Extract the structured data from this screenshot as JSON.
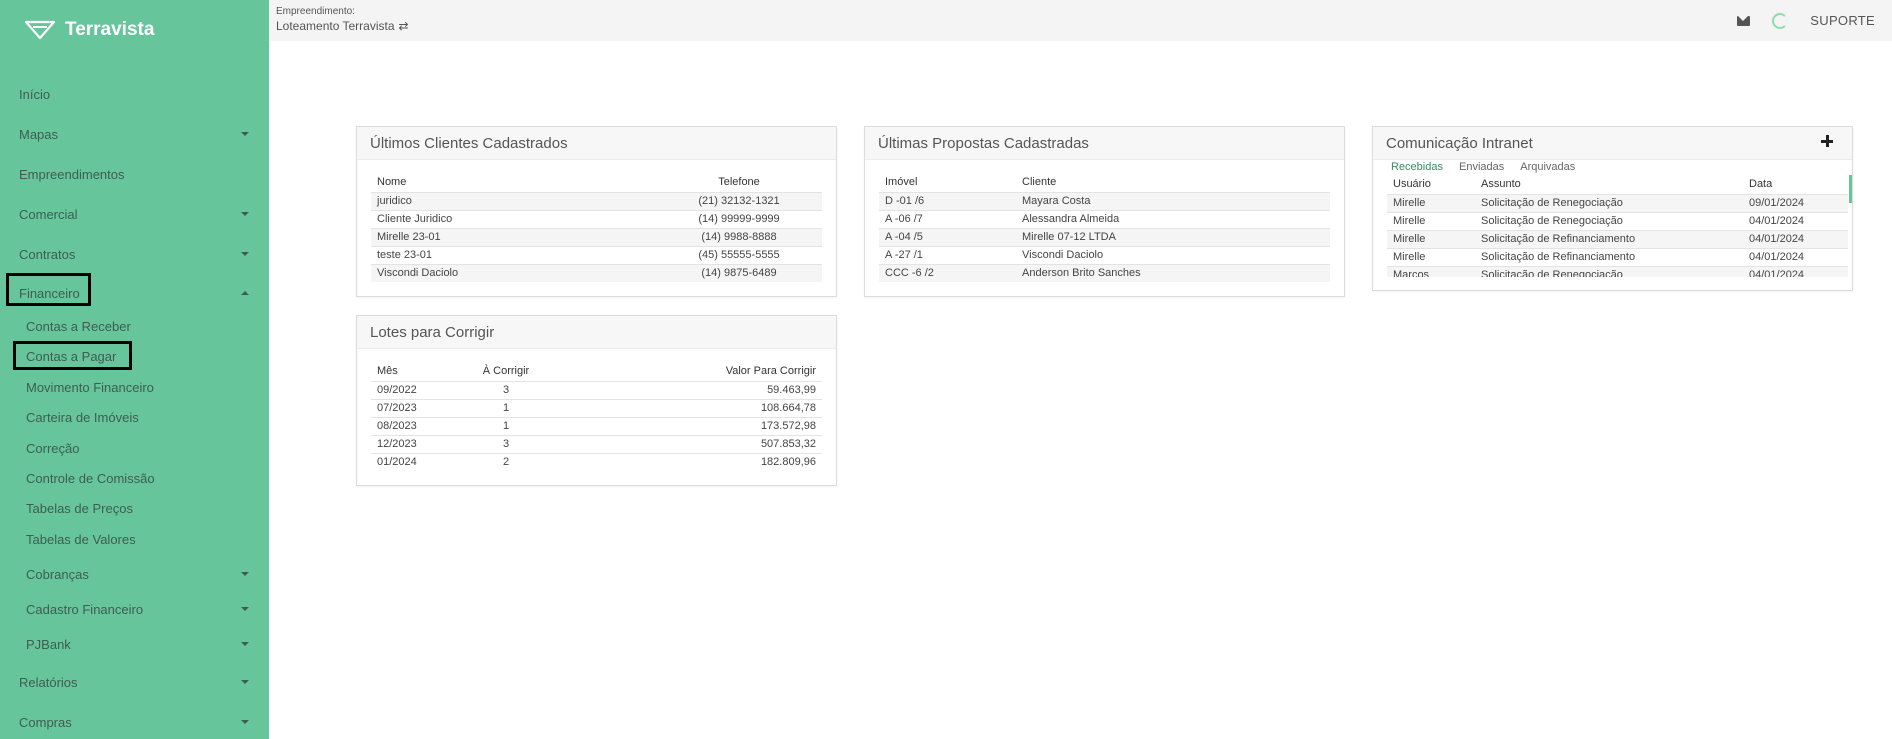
{
  "brand": {
    "name": "Terravista",
    "logo_icon": "terravista-triangle-logo"
  },
  "sidebar": {
    "items": [
      {
        "label": "Início",
        "has_caret": false
      },
      {
        "label": "Mapas",
        "has_caret": true
      },
      {
        "label": "Empreendimentos",
        "has_caret": false
      },
      {
        "label": "Comercial",
        "has_caret": true
      },
      {
        "label": "Contratos",
        "has_caret": true
      },
      {
        "label": "Financeiro",
        "has_caret": true,
        "expanded": true
      }
    ],
    "financeiro_sub": [
      {
        "label": "Contas a Receber"
      },
      {
        "label": "Contas a Pagar"
      },
      {
        "label": "Movimento Financeiro"
      },
      {
        "label": "Carteira de Imóveis"
      },
      {
        "label": "Correção"
      },
      {
        "label": "Controle de Comissão"
      },
      {
        "label": "Tabelas de Preços"
      },
      {
        "label": "Tabelas de Valores"
      },
      {
        "label": "Cobranças",
        "has_caret": true
      },
      {
        "label": "Cadastro Financeiro",
        "has_caret": true
      },
      {
        "label": "PJBank",
        "has_caret": true
      }
    ],
    "bottom_items": [
      {
        "label": "Relatórios",
        "has_caret": true
      },
      {
        "label": "Compras",
        "has_caret": true
      }
    ]
  },
  "topbar": {
    "empreendimento_label": "Empreendimento:",
    "empreendimento_value": "Loteamento Terravista",
    "swap_icon": "⇄",
    "support_label": "SUPORTE"
  },
  "clientes": {
    "title": "Últimos Clientes Cadastrados",
    "headers": [
      "Nome",
      "Telefone"
    ],
    "rows": [
      [
        "juridico",
        "(21) 32132-1321"
      ],
      [
        "Cliente Juridico",
        "(14) 99999-9999"
      ],
      [
        "Mirelle 23-01",
        "(14) 9988-8888"
      ],
      [
        "teste 23-01",
        "(45) 55555-5555"
      ],
      [
        "Viscondi Daciolo",
        "(14) 9875-6489"
      ]
    ]
  },
  "propostas": {
    "title": "Últimas Propostas Cadastradas",
    "headers": [
      "Imóvel",
      "Cliente"
    ],
    "rows": [
      [
        "D -01 /6",
        "Mayara Costa"
      ],
      [
        "A -06 /7",
        "Alessandra Almeida"
      ],
      [
        "A -04 /5",
        "Mirelle 07-12 LTDA"
      ],
      [
        "A -27 /1",
        "Viscondi Daciolo"
      ],
      [
        "CCC -6 /2",
        "Anderson Brito Sanches"
      ]
    ]
  },
  "intranet": {
    "title": "Comunicação Intranet",
    "tabs": [
      "Recebidas",
      "Enviadas",
      "Arquivadas"
    ],
    "headers": [
      "Usuário",
      "Assunto",
      "Data"
    ],
    "rows": [
      [
        "Mirelle",
        "Solicitação de Renegociação",
        "09/01/2024"
      ],
      [
        "Mirelle",
        "Solicitação de Renegociação",
        "04/01/2024"
      ],
      [
        "Mirelle",
        "Solicitação de Refinanciamento",
        "04/01/2024"
      ],
      [
        "Mirelle",
        "Solicitação de Refinanciamento",
        "04/01/2024"
      ],
      [
        "Marcos",
        "Solicitação de Renegociação",
        "04/01/2024"
      ]
    ]
  },
  "lotes": {
    "title": "Lotes para Corrigir",
    "headers": [
      "Mês",
      "À Corrigir",
      "Valor Para Corrigir"
    ],
    "rows": [
      [
        "09/2022",
        "3",
        "59.463,99"
      ],
      [
        "07/2023",
        "1",
        "108.664,78"
      ],
      [
        "08/2023",
        "1",
        "173.572,98"
      ],
      [
        "12/2023",
        "3",
        "507.853,32"
      ],
      [
        "01/2024",
        "2",
        "182.809,96"
      ]
    ]
  },
  "colors": {
    "sidebar_bg": "#66c59b",
    "accent": "#3a8a61"
  }
}
